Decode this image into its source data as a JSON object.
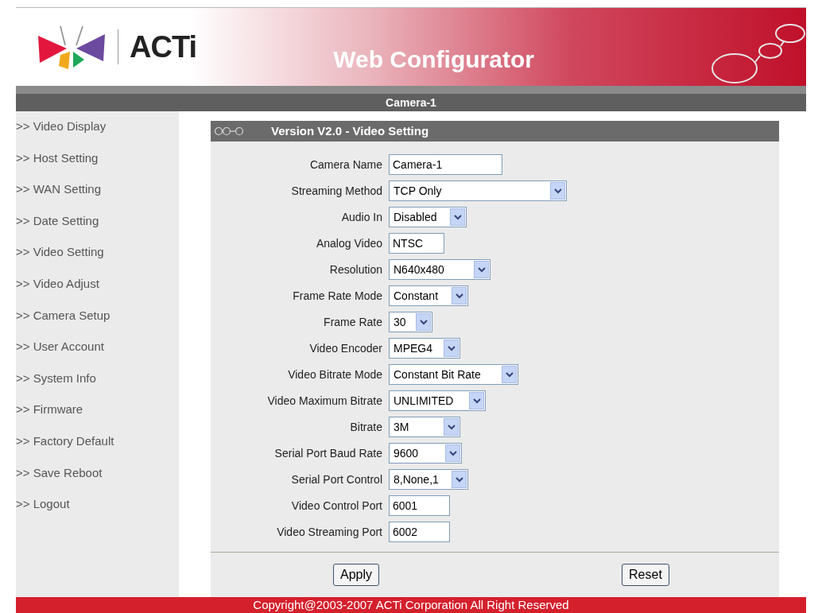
{
  "header": {
    "brand": "ACTi",
    "title": "Web Configurator"
  },
  "camera_bar": {
    "title": "Camera-1"
  },
  "sidebar": {
    "items": [
      {
        "label": ">> Video Display"
      },
      {
        "label": ">> Host Setting"
      },
      {
        "label": ">> WAN Setting"
      },
      {
        "label": ">> Date Setting"
      },
      {
        "label": ">> Video Setting"
      },
      {
        "label": ">> Video Adjust"
      },
      {
        "label": ">> Camera Setup"
      },
      {
        "label": ">> User Account"
      },
      {
        "label": ">> System Info"
      },
      {
        "label": ">> Firmware"
      },
      {
        "label": ">> Factory Default"
      },
      {
        "label": ">> Save Reboot"
      },
      {
        "label": ">> Logout"
      }
    ]
  },
  "panel": {
    "title": "Version V2.0 - Video Setting",
    "fields": [
      {
        "label": "Camera Name",
        "kind": "text",
        "value": "Camera-1"
      },
      {
        "label": "Streaming Method",
        "kind": "select",
        "value": "TCP Only"
      },
      {
        "label": "Audio In",
        "kind": "select",
        "value": "Disabled"
      },
      {
        "label": "Analog Video",
        "kind": "text",
        "value": "NTSC"
      },
      {
        "label": "Resolution",
        "kind": "select",
        "value": "N640x480"
      },
      {
        "label": "Frame Rate Mode",
        "kind": "select",
        "value": "Constant"
      },
      {
        "label": "Frame Rate",
        "kind": "select",
        "value": "30"
      },
      {
        "label": "Video Encoder",
        "kind": "select",
        "value": "MPEG4"
      },
      {
        "label": "Video Bitrate Mode",
        "kind": "select",
        "value": "Constant Bit Rate"
      },
      {
        "label": "Video Maximum Bitrate",
        "kind": "select",
        "value": "UNLIMITED"
      },
      {
        "label": "Bitrate",
        "kind": "select",
        "value": "3M"
      },
      {
        "label": "Serial Port Baud Rate",
        "kind": "select",
        "value": "9600"
      },
      {
        "label": "Serial Port Control",
        "kind": "select",
        "value": "8,None,1"
      },
      {
        "label": "Video Control Port",
        "kind": "text",
        "value": "6001"
      },
      {
        "label": "Video Streaming Port",
        "kind": "text",
        "value": "6002"
      }
    ],
    "buttons": [
      "Apply",
      "Reset"
    ]
  },
  "footer": {
    "text": "Copyright@2003-2007 ACTi Corporation All Right Reserved"
  }
}
